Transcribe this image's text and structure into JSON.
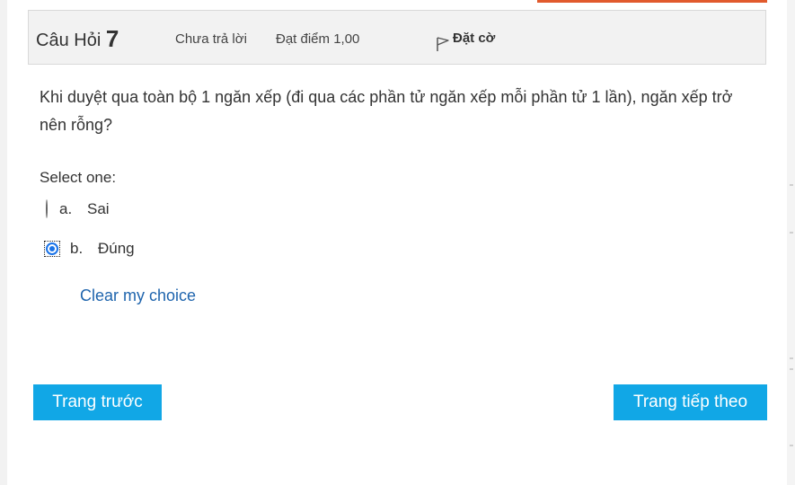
{
  "question": {
    "prefix": "Câu Hỏi",
    "number": "7",
    "state": "Chưa trả lời",
    "mark": "Đạt điểm 1,00",
    "flag_label": "Đặt cờ",
    "text": "Khi duyệt qua toàn bộ 1 ngăn xếp (đi qua các phần tử ngăn xếp mỗi phần tử 1 lần), ngăn xếp trở nên rỗng?",
    "prompt": "Select one:",
    "answers": [
      {
        "letter": "a.",
        "label": "Sai",
        "selected": false
      },
      {
        "letter": "b.",
        "label": "Đúng",
        "selected": true
      }
    ],
    "clear_label": "Clear my choice"
  },
  "navigation": {
    "prev_label": "Trang trước",
    "next_label": "Trang tiếp theo"
  },
  "colors": {
    "accent_top": "#e15a2d",
    "button": "#11a7e6",
    "link": "#1e64ad",
    "radio_selected": "#1a73e8"
  }
}
